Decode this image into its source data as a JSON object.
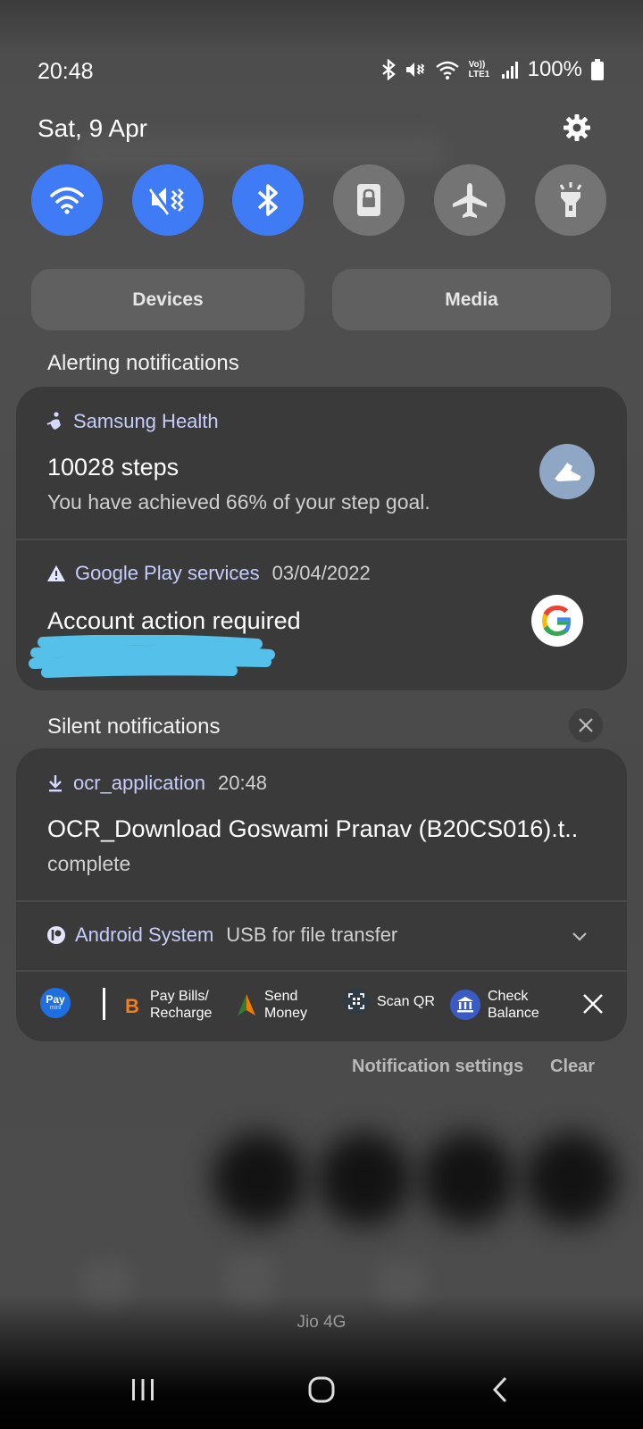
{
  "status_bar": {
    "time": "20:48",
    "network_label": "Vo)) LTE1",
    "battery": "100%"
  },
  "header": {
    "date": "Sat, 9 Apr",
    "settings_icon": "gear-icon"
  },
  "quick_toggles": [
    {
      "name": "wifi",
      "icon": "wifi-icon",
      "active": true
    },
    {
      "name": "mute",
      "icon": "mute-vibrate-icon",
      "active": true
    },
    {
      "name": "bluetooth",
      "icon": "bluetooth-icon",
      "active": true
    },
    {
      "name": "lock",
      "icon": "lock-icon",
      "active": false
    },
    {
      "name": "airplane",
      "icon": "airplane-icon",
      "active": false
    },
    {
      "name": "flashlight",
      "icon": "flashlight-icon",
      "active": false
    }
  ],
  "buttons": {
    "devices": "Devices",
    "media": "Media"
  },
  "alerting": {
    "label": "Alerting notifications",
    "health": {
      "app": "Samsung Health",
      "title": "10028 steps",
      "body": "You have achieved 66% of your step goal."
    },
    "google": {
      "app": "Google Play services",
      "time": "03/04/2022",
      "title": "Account action required"
    }
  },
  "silent": {
    "label": "Silent notifications",
    "ocr": {
      "app": "ocr_application",
      "time": "20:48",
      "title": "OCR_Download Goswami Pranav (B20CS016).t..",
      "body": "complete"
    },
    "android": {
      "app": "Android System",
      "text": "USB for file transfer"
    },
    "paytm": {
      "logo_top": "Pay",
      "logo_bottom": "mini",
      "items": [
        {
          "line1": "Pay Bills/",
          "line2": "Recharge"
        },
        {
          "line1": "Send",
          "line2": "Money"
        },
        {
          "line1": "Scan QR",
          "line2": ""
        },
        {
          "line1": "Check",
          "line2": "Balance"
        }
      ]
    }
  },
  "footer": {
    "notification_settings": "Notification settings",
    "clear": "Clear",
    "carrier": "Jio 4G"
  },
  "colors": {
    "accent_blue": "#3e7bf5",
    "card": "#3a3a3a",
    "app_name": "#c7cdfb",
    "redaction": "#55c0ea"
  }
}
